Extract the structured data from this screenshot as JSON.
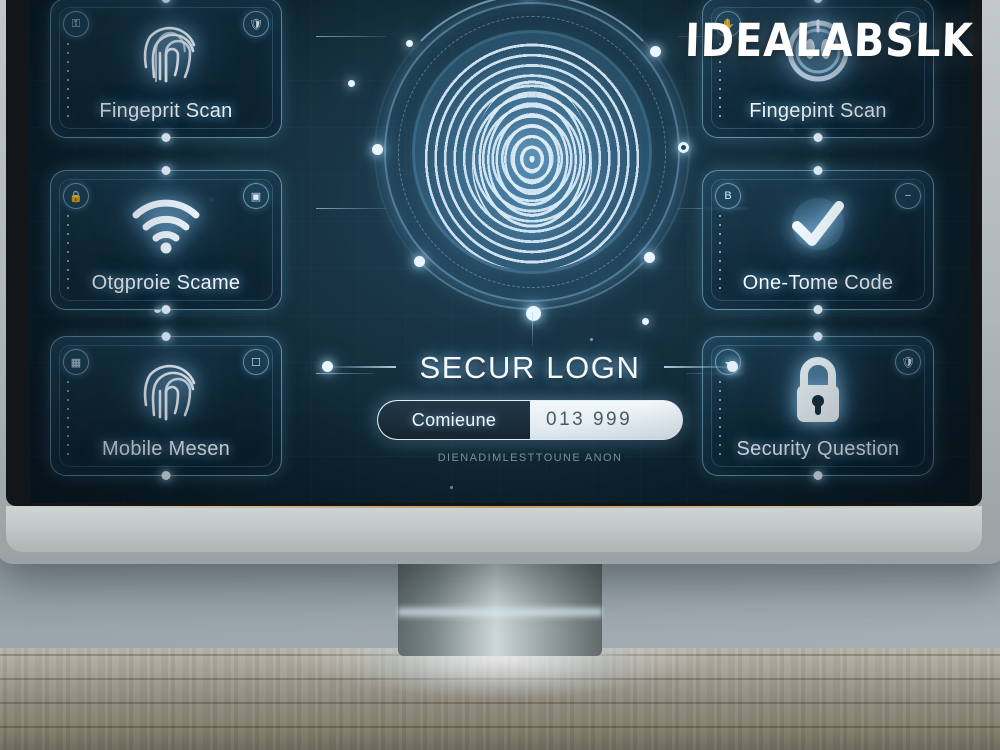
{
  "watermark": "IDEALABSLK",
  "screen": {
    "center": {
      "title": "SECUR LOGN",
      "subtitle": "DIENADIMLESTTOUNE ANON",
      "input": {
        "label": "Comieune",
        "value": "013 999"
      },
      "hologram_icon": "fingerprint-hologram-icon"
    },
    "cards": [
      {
        "id": "fingerprint-scan-left",
        "label": "Fingeprit Scan",
        "icon": "fingerprint-icon",
        "badge_left": "key-icon",
        "badge_right": "shield-icon",
        "column": "left",
        "row": 1
      },
      {
        "id": "wifi-scan",
        "label": "Otgproie Scame",
        "icon": "wifi-icon",
        "badge_left": "lock-icon",
        "badge_right": "chip-icon",
        "column": "left",
        "row": 2
      },
      {
        "id": "mobile-mesen",
        "label": "Mobile Mesen",
        "icon": "fingerprint-icon",
        "badge_left": "id-card-icon",
        "badge_right": "device-icon",
        "column": "left",
        "row": 3
      },
      {
        "id": "fingerprint-scan-right",
        "label": "Fingepint Scan",
        "icon": "face-scan-icon",
        "badge_left": "hand-icon",
        "badge_right": "fingerprint-icon",
        "column": "right",
        "row": 1
      },
      {
        "id": "one-time-code",
        "label": "One-Tome Code",
        "icon": "checkmark-icon",
        "badge_left": "bitcoin-icon",
        "badge_right": "minus-icon",
        "column": "right",
        "row": 2
      },
      {
        "id": "security-question",
        "label": "Security Question",
        "icon": "padlock-icon",
        "badge_left": "fingerprint-icon",
        "badge_right": "shield-icon",
        "column": "right",
        "row": 3
      }
    ]
  },
  "colors": {
    "screen_bg": "#16313f",
    "accent_glow": "#bfe6ff",
    "card_border": "#a0d7f5",
    "text_primary": "#f2f8fd",
    "desk": "#938e81",
    "bezel": "#131618",
    "chin": "#c3caca"
  }
}
